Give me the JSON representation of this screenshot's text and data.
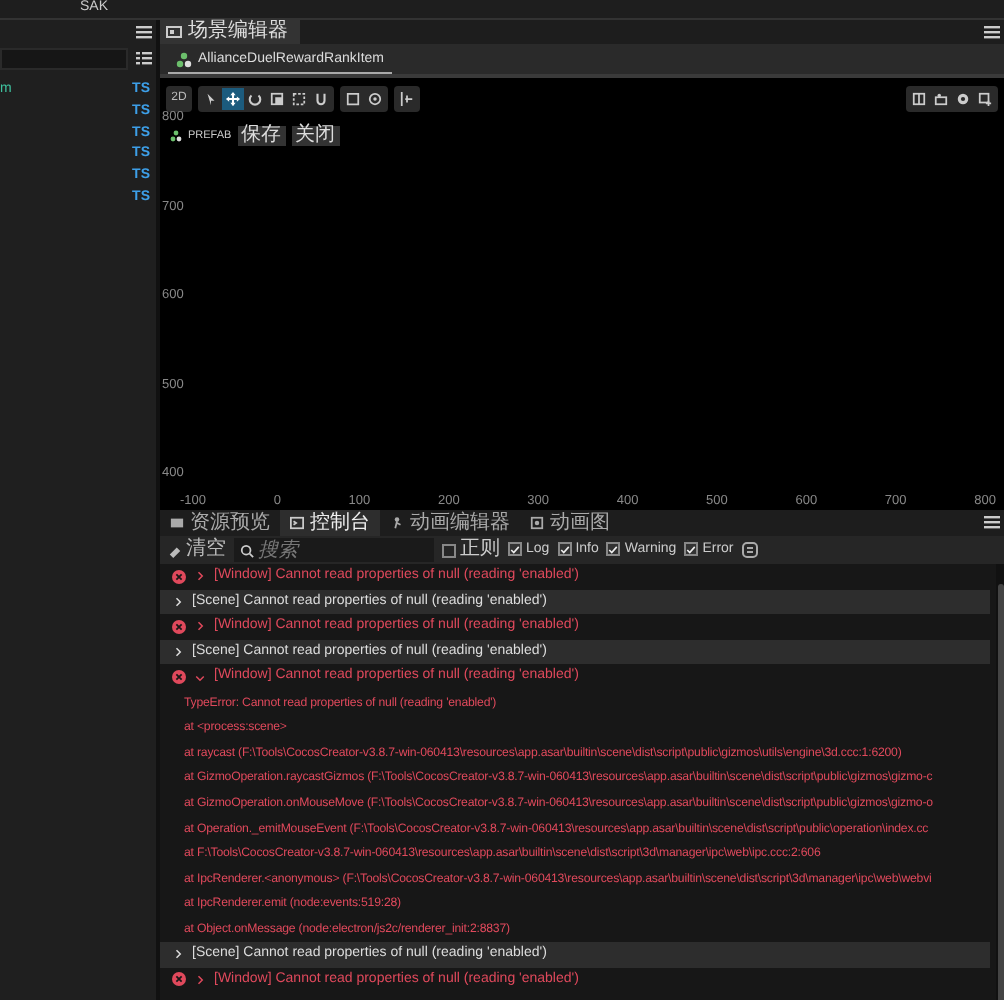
{
  "top_bar": {
    "title": "SAK"
  },
  "hierarchy": {
    "items": [
      {
        "label": "m",
        "type": "TS"
      },
      {
        "type": "TS"
      },
      {
        "type": "TS"
      },
      {
        "type": "TS"
      },
      {
        "type": "TS"
      },
      {
        "type": "TS"
      }
    ]
  },
  "scene_editor": {
    "tab": "场景编辑器",
    "document_tab": "AllianceDuelRewardRankItem",
    "mode_button": "2D",
    "tools": [
      {
        "selected": false
      },
      {
        "selected": true
      },
      {
        "selected": false
      },
      {
        "selected": false
      },
      {
        "selected": false
      },
      {
        "selected": false
      }
    ],
    "prefab": {
      "label": "PREFAB",
      "buttons": [
        "保存",
        "关闭"
      ]
    },
    "y_ticks": [
      "800",
      "700",
      "600",
      "500",
      "400"
    ],
    "x_ticks": [
      "-100",
      "0",
      "100",
      "200",
      "300",
      "400",
      "500",
      "600",
      "700",
      "800"
    ]
  },
  "bottom_tabs": [
    {
      "label": "资源预览",
      "selected": false
    },
    {
      "label": "控制台",
      "selected": true
    },
    {
      "label": "动画编辑器",
      "selected": false
    },
    {
      "label": "动画图",
      "selected": false
    }
  ],
  "console": {
    "clear_button": "清空",
    "search_placeholder": "搜索",
    "filters": [
      {
        "label": "正则",
        "checked": false
      },
      {
        "label": "Log",
        "checked": true
      },
      {
        "label": "Info",
        "checked": true
      },
      {
        "label": "Warning",
        "checked": true
      },
      {
        "label": "Error",
        "checked": true
      }
    ],
    "entries": [
      {
        "kind": "error",
        "expanded": false,
        "text": "[Window] Cannot read properties of null (reading 'enabled')"
      },
      {
        "kind": "log",
        "text": "[Scene] Cannot read properties of null (reading 'enabled')"
      },
      {
        "kind": "error",
        "expanded": false,
        "text": "[Window] Cannot read properties of null (reading 'enabled')"
      },
      {
        "kind": "log",
        "text": "[Scene] Cannot read properties of null (reading 'enabled')"
      },
      {
        "kind": "error",
        "expanded": true,
        "text": "[Window] Cannot read properties of null (reading 'enabled')",
        "details": [
          "TypeError: Cannot read properties of null (reading 'enabled')",
          "at <process:scene>",
          "at raycast (F:\\Tools\\CocosCreator-v3.8.7-win-060413\\resources\\app.asar\\builtin\\scene\\dist\\script\\public\\gizmos\\utils\\engine\\3d.ccc:1:6200)",
          "at GizmoOperation.raycastGizmos (F:\\Tools\\CocosCreator-v3.8.7-win-060413\\resources\\app.asar\\builtin\\scene\\dist\\script\\public\\gizmos\\gizmo-c",
          "at GizmoOperation.onMouseMove (F:\\Tools\\CocosCreator-v3.8.7-win-060413\\resources\\app.asar\\builtin\\scene\\dist\\script\\public\\gizmos\\gizmo-o",
          "at Operation._emitMouseEvent (F:\\Tools\\CocosCreator-v3.8.7-win-060413\\resources\\app.asar\\builtin\\scene\\dist\\script\\public\\operation\\index.cc",
          "at F:\\Tools\\CocosCreator-v3.8.7-win-060413\\resources\\app.asar\\builtin\\scene\\dist\\script\\3d\\manager\\ipc\\web\\ipc.ccc:2:606",
          "at IpcRenderer.<anonymous> (F:\\Tools\\CocosCreator-v3.8.7-win-060413\\resources\\app.asar\\builtin\\scene\\dist\\script\\3d\\manager\\ipc\\web\\webvi",
          "at IpcRenderer.emit (node:events:519:28)",
          "at Object.onMessage (node:electron/js2c/renderer_init:2:8837)"
        ]
      },
      {
        "kind": "log",
        "text": "[Scene] Cannot read properties of null (reading 'enabled')"
      },
      {
        "kind": "error",
        "expanded": false,
        "text": "[Window] Cannot read properties of null (reading 'enabled')"
      }
    ]
  }
}
